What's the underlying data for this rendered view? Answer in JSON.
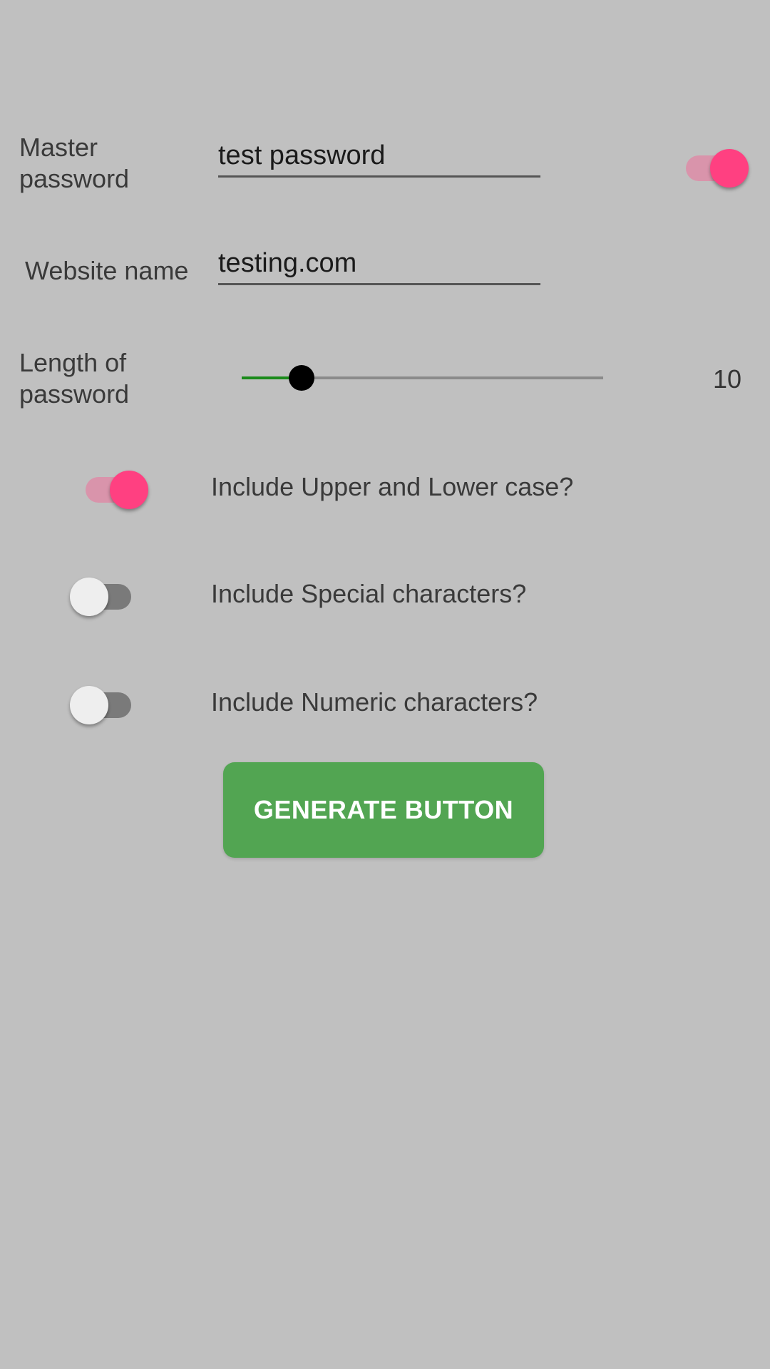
{
  "colors": {
    "background": "#c0c0c0",
    "accent_pink": "#ff4081",
    "switch_on_track": "#d994ab",
    "switch_off_thumb": "#eeeeee",
    "switch_off_track": "#7a7a7a",
    "slider_fill": "#1a8a1a",
    "slider_knob": "#000000",
    "button_green": "#52a552",
    "button_text": "#ffffff"
  },
  "master_password": {
    "label_line1": "Master",
    "label_line2": "password",
    "value": "test password",
    "visibility_toggle_on": true
  },
  "website": {
    "label": "Website name",
    "value": "testing.com"
  },
  "length": {
    "label_line1": "Length of",
    "label_line2": "password",
    "value": "10",
    "slider_fraction": 0.165
  },
  "options": [
    {
      "label": "Include Upper and Lower case?",
      "on": true
    },
    {
      "label": "Include Special characters?",
      "on": false
    },
    {
      "label": "Include Numeric characters?",
      "on": false
    }
  ],
  "generate": {
    "label": "GENERATE BUTTON"
  }
}
